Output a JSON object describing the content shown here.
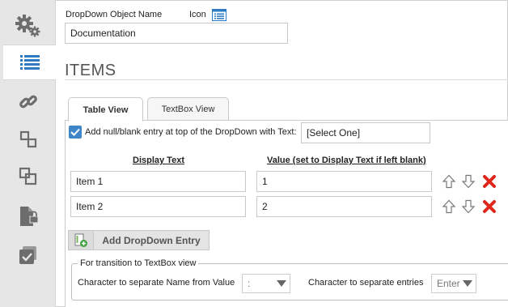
{
  "header": {
    "object_name_label": "DropDown Object Name",
    "object_name_value": "Documentation",
    "icon_label": "Icon"
  },
  "section_title": "ITEMS",
  "tabs": [
    {
      "label": "Table View",
      "active": true
    },
    {
      "label": "TextBox View",
      "active": false
    }
  ],
  "null_entry": {
    "checked": true,
    "label": "Add null/blank entry at top of the DropDown with Text:",
    "value": "[Select One]"
  },
  "columns": {
    "display_text": "Display Text",
    "value": "Value (set to Display Text if left blank)"
  },
  "rows": [
    {
      "display": "Item 1",
      "value": "1"
    },
    {
      "display": "Item 2",
      "value": "2"
    }
  ],
  "add_button": "Add DropDown Entry",
  "transition": {
    "legend": "For transition to TextBox view",
    "separator_name_label": "Character to separate Name from Value",
    "separator_name_value": ":",
    "separator_entries_label": "Character to separate entries",
    "separator_entries_value": "Enter"
  },
  "colors": {
    "accent": "#3f86c9",
    "delete": "#e0261b",
    "sidebar_bg": "#e6e6e6",
    "icon_gray": "#6d6d6d"
  },
  "icons": [
    "gears-icon",
    "list-icon",
    "link-icon",
    "move-icon",
    "copy-icon",
    "lock-file-icon",
    "check-file-icon",
    "list-image-icon",
    "arrow-up-icon",
    "arrow-down-icon",
    "delete-icon",
    "add-entry-icon"
  ]
}
